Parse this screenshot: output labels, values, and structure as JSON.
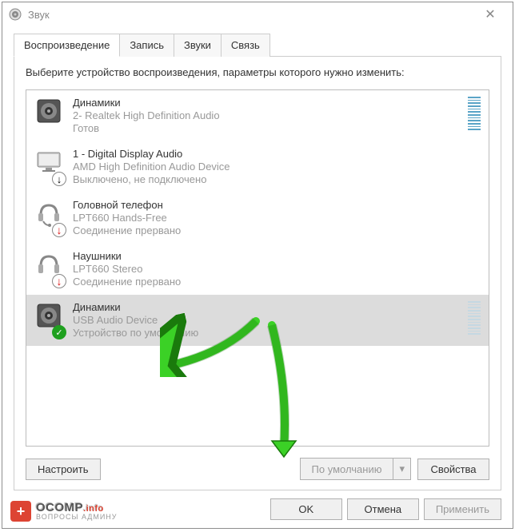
{
  "window": {
    "title": "Звук"
  },
  "tabs": [
    {
      "label": "Воспроизведение",
      "active": true
    },
    {
      "label": "Запись",
      "active": false
    },
    {
      "label": "Звуки",
      "active": false
    },
    {
      "label": "Связь",
      "active": false
    }
  ],
  "instruction": "Выберите устройство воспроизведения, параметры которого нужно изменить:",
  "devices": [
    {
      "icon": "speaker",
      "overlay": null,
      "name": "Динамики",
      "desc": "2- Realtek High Definition Audio",
      "status": "Готов",
      "meter": "active",
      "selected": false
    },
    {
      "icon": "monitor",
      "overlay": "down",
      "name": "1 - Digital Display Audio",
      "desc": "AMD High Definition Audio Device",
      "status": "Выключено, не подключено",
      "meter": null,
      "selected": false
    },
    {
      "icon": "headset",
      "overlay": "redx",
      "name": "Головной телефон",
      "desc": "LPT660 Hands-Free",
      "status": "Соединение прервано",
      "meter": null,
      "selected": false
    },
    {
      "icon": "headphone",
      "overlay": "redx",
      "name": "Наушники",
      "desc": "LPT660 Stereo",
      "status": "Соединение прервано",
      "meter": null,
      "selected": false
    },
    {
      "icon": "speaker",
      "overlay": "check",
      "name": "Динамики",
      "desc": "USB Audio Device",
      "status": "Устройство по умолчанию",
      "meter": "dim",
      "selected": true
    }
  ],
  "buttons": {
    "configure": "Настроить",
    "default": "По умолчанию",
    "properties": "Свойства",
    "ok": "OK",
    "cancel": "Отмена",
    "apply": "Применить"
  },
  "watermark": {
    "main": "OCOMP",
    "suffix": ".info",
    "sub": "ВОПРОСЫ АДМИНУ"
  }
}
